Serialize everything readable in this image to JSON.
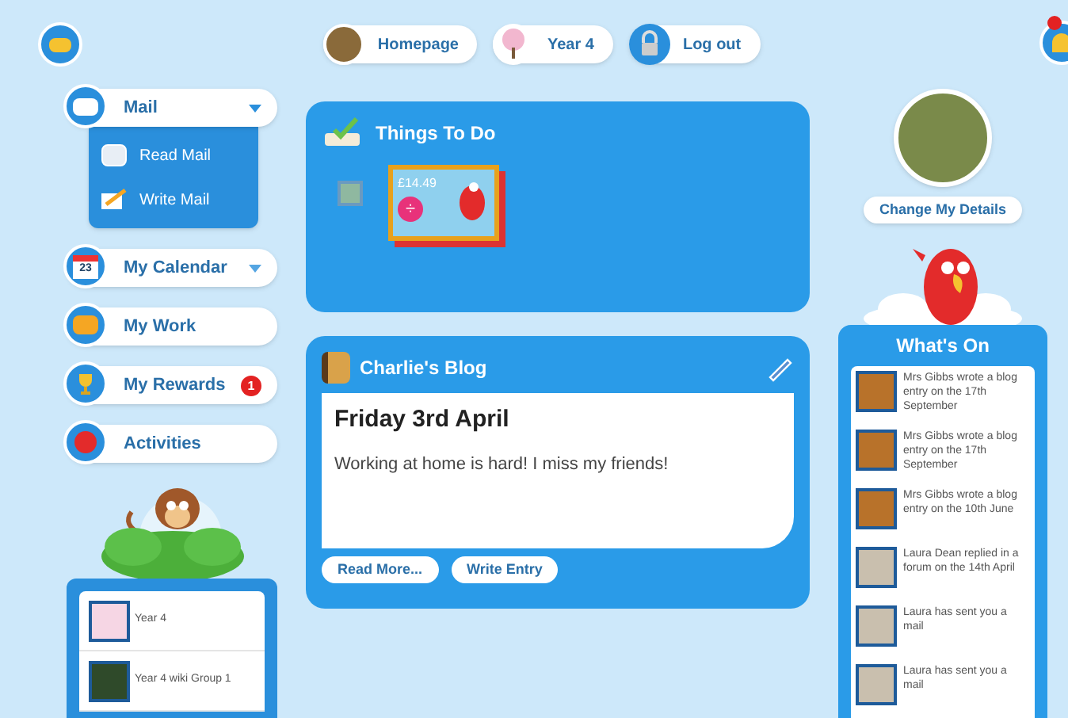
{
  "header": {
    "nav": [
      {
        "label": "Homepage",
        "kind": "photo"
      },
      {
        "label": "Year 4",
        "kind": "tree"
      },
      {
        "label": "Log out",
        "kind": "lock"
      }
    ]
  },
  "sidebar": {
    "items": [
      {
        "label": "Mail",
        "kind": "mail",
        "expanded": true,
        "children": [
          {
            "label": "Read Mail",
            "kind": "read"
          },
          {
            "label": "Write Mail",
            "kind": "write"
          }
        ]
      },
      {
        "label": "My Calendar",
        "kind": "calendar",
        "day": "23",
        "expanded": false
      },
      {
        "label": "My Work",
        "kind": "work"
      },
      {
        "label": "My Rewards",
        "kind": "trophy",
        "badge": "1"
      },
      {
        "label": "Activities",
        "kind": "activities"
      }
    ]
  },
  "groups": [
    {
      "label": "Year 4",
      "kind": "tree"
    },
    {
      "label": "Year 4 wiki Group 1",
      "kind": "forest"
    }
  ],
  "things_to_do": {
    "title": "Things To Do",
    "tasks": [
      {
        "kind": "small"
      },
      {
        "kind": "large",
        "price": "£14.49",
        "symbol": "÷"
      }
    ]
  },
  "blog": {
    "title": "Charlie's Blog",
    "entry_title": "Friday 3rd April",
    "entry_text": "Working at home is hard! I miss my friends!",
    "buttons": [
      "Read More...",
      "Write Entry"
    ]
  },
  "profile": {
    "button": "Change My Details"
  },
  "whats_on": {
    "title": "What's On",
    "items": [
      {
        "text": "Mrs Gibbs wrote a blog entry on the 17th September",
        "kind": "blog"
      },
      {
        "text": "Mrs Gibbs wrote a blog entry on the 17th September",
        "kind": "blog"
      },
      {
        "text": "Mrs Gibbs wrote a blog entry on the 10th June",
        "kind": "blog"
      },
      {
        "text": "Laura Dean replied in a forum on the 14th April",
        "kind": "person"
      },
      {
        "text": "Laura has sent you a mail",
        "kind": "person"
      },
      {
        "text": "Laura has sent you a mail",
        "kind": "person"
      }
    ]
  }
}
